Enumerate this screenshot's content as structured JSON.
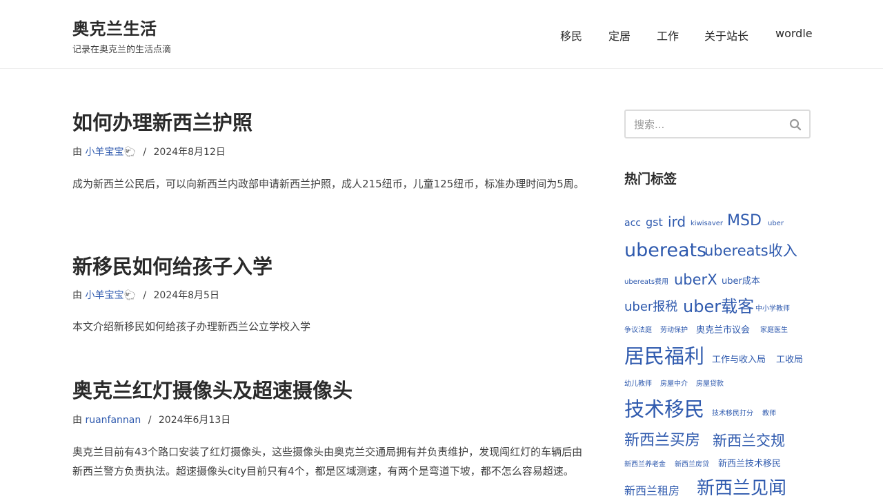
{
  "site": {
    "title": "奥克兰生活",
    "tagline": "记录在奥克兰的生活点滴"
  },
  "nav": {
    "items": [
      {
        "label": "移民"
      },
      {
        "label": "定居"
      },
      {
        "label": "工作"
      },
      {
        "label": "关于站长"
      },
      {
        "label": "wordle"
      }
    ]
  },
  "posts": [
    {
      "title": "如何办理新西兰护照",
      "by": "由",
      "author": "小羊宝宝🐑",
      "sep": "/",
      "date": "2024年8月12日",
      "excerpt": "成为新西兰公民后，可以向新西兰内政部申请新西兰护照，成人215纽币，儿童125纽币，标准办理时间为5周。"
    },
    {
      "title": "新移民如何给孩子入学",
      "by": "由",
      "author": "小羊宝宝🐑",
      "sep": "/",
      "date": "2024年8月5日",
      "excerpt": "本文介绍新移民如何给孩子办理新西兰公立学校入学"
    },
    {
      "title": "奥克兰红灯摄像头及超速摄像头",
      "by": "由",
      "author": "ruanfannan",
      "sep": "/",
      "date": "2024年6月13日",
      "excerpt": "奥克兰目前有43个路口安装了红灯摄像头，这些摄像头由奥克兰交通局拥有并负责维护，发现闯红灯的车辆后由新西兰警方负责执法。超速摄像头city目前只有4个，都是区域测速，有两个是弯道下坡，都不怎么容易超速。"
    }
  ],
  "sidebar": {
    "search": {
      "placeholder": "搜索..."
    },
    "tags_title": "热门标签",
    "tags": [
      "acc",
      "gst",
      "ird",
      "kiwisaver",
      "MSD",
      "uber",
      "ubereats",
      "ubereats收入",
      "ubereats费用",
      "uberX",
      "uber成本",
      "uber报税",
      "uber载客",
      "中小学教师",
      "争议法庭",
      "劳动保护",
      "奥克兰市议会",
      "家庭医生",
      "居民福利",
      "工作与收入局",
      "工收局",
      "幼儿教师",
      "房屋中介",
      "房屋贷款",
      "技术移民",
      "技术移民打分",
      "教师",
      "新西兰买房",
      "新西兰交规",
      "新西兰养老金",
      "新西兰房贷",
      "新西兰技术移民",
      "新西兰租房",
      "新西兰见闻"
    ]
  },
  "colors": {
    "link": "#2f5aae",
    "text": "#2a2a2a"
  },
  "icons": {
    "search": "search-icon"
  }
}
